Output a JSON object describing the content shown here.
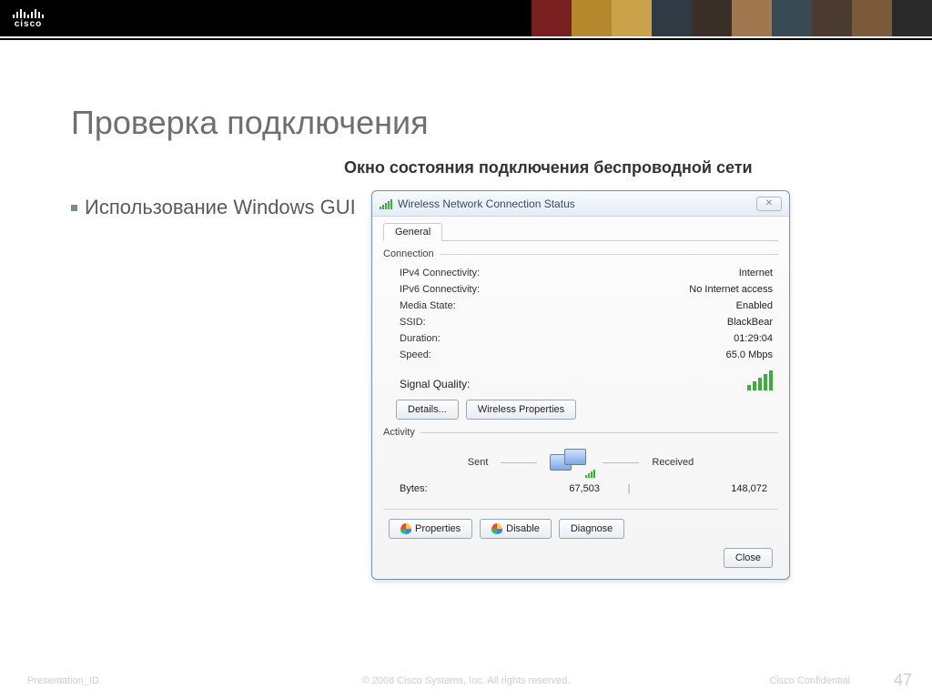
{
  "brand": {
    "name": "cisco"
  },
  "slide": {
    "title": "Проверка подключения",
    "subtitle": "Окно состояния подключения беспроводной сети",
    "bullet1": "Использование Windows GUI"
  },
  "dialog": {
    "title": "Wireless Network Connection Status",
    "tab_general": "General",
    "group_connection": "Connection",
    "ipv4_label": "IPv4 Connectivity:",
    "ipv4_value": "Internet",
    "ipv6_label": "IPv6 Connectivity:",
    "ipv6_value": "No Internet access",
    "media_label": "Media State:",
    "media_value": "Enabled",
    "ssid_label": "SSID:",
    "ssid_value": "BlackBear",
    "duration_label": "Duration:",
    "duration_value": "01:29:04",
    "speed_label": "Speed:",
    "speed_value": "65.0 Mbps",
    "sigq_label": "Signal Quality:",
    "details_btn": "Details...",
    "wprops_btn": "Wireless Properties",
    "group_activity": "Activity",
    "sent_label": "Sent",
    "recv_label": "Received",
    "bytes_label": "Bytes:",
    "bytes_sent": "67,503",
    "bytes_recv": "148,072",
    "props_btn": "Properties",
    "disable_btn": "Disable",
    "diagnose_btn": "Diagnose",
    "close_btn": "Close"
  },
  "footer": {
    "left": "Presentation_ID",
    "center": "© 2008 Cisco Systems, Inc. All rights reserved.",
    "right": "Cisco Confidential",
    "page": "47"
  },
  "photostrip_colors": [
    "#7a1f1f",
    "#b58a2e",
    "#c9a24a",
    "#2f3a44",
    "#3b2f2a",
    "#a07850",
    "#394a55",
    "#4a3a30",
    "#7a5a3a",
    "#2a2a2a"
  ]
}
